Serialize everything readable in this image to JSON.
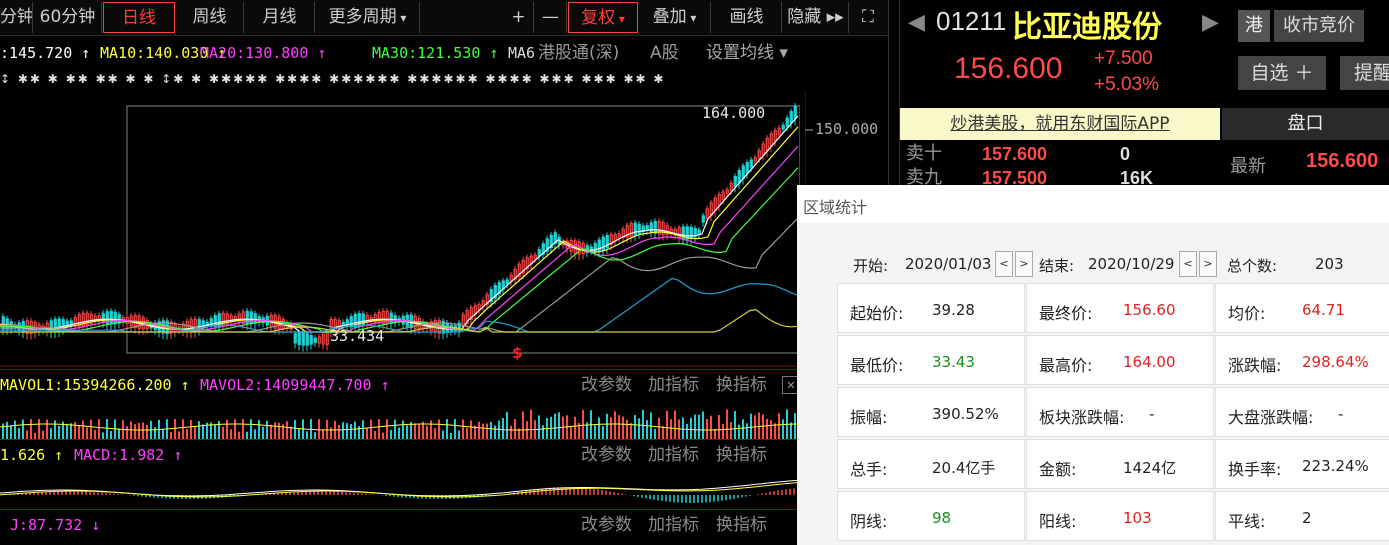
{
  "toolbar": {
    "items": [
      "分钟",
      "60分钟",
      "日线",
      "周线",
      "月线",
      "更多周期",
      "+",
      "—",
      "复权",
      "叠加",
      "画线",
      "隐藏",
      "⛶"
    ]
  },
  "ma_legend": [
    {
      "text": ":145.720 ↑",
      "color": "#ffffff"
    },
    {
      "text": "MA10:140.030 ↑",
      "color": "#ffff40"
    },
    {
      "text": "MA20:130.800 ↑",
      "color": "#ff40ff"
    },
    {
      "text": "MA30:121.530 ↑",
      "color": "#40ff40"
    },
    {
      "text": "MA6",
      "color": "#dddddd"
    }
  ],
  "chart_tabs": {
    "hk_connect": "港股通(深)",
    "a_share": "A股",
    "settings": "设置均线"
  },
  "markers": "↕ ✱✱ ✱   ✱✱ ✱✱   ✱ ✱  ↕✱ ✱   ✱✱✱✱✱ ✱✱✱✱ ✱✱✱✱✱✱  ✱✱✱✱✱✱ ✱✱✱✱  ✱✱✱ ✱✱✱  ✱✱ ✱",
  "price_axis": {
    "label": "150.000"
  },
  "peak_label": "164.000",
  "trough_label": "33.434",
  "s_marker": "$",
  "indicators": [
    {
      "left": "MAVOL1:15394266.200 ↑",
      "right": "MAVOL2:14099447.700 ↑",
      "left_color": "#ffff40",
      "right_color": "#ff40ff"
    },
    {
      "left": "1.626 ↑",
      "right": "MACD:1.982 ↑",
      "left_color": "#ffff40",
      "right_color": "#ff40ff"
    },
    {
      "left": "J:87.732 ↓",
      "right": "",
      "left_color": "#ff40ff",
      "right_color": "#ff40ff"
    }
  ],
  "indicator_buttons": {
    "params": "改参数",
    "add": "加指标",
    "switch": "换指标",
    "close": "✕"
  },
  "stock": {
    "code": "01211",
    "name": "比亚迪股份",
    "market": "港",
    "auction": "收市竞价",
    "price": "156.600",
    "change": "+7.500",
    "change_pct": "+5.03%",
    "watch": "自选 ＋",
    "remind": "提醒"
  },
  "ad_text": "炒港美股，就用东财国际APP",
  "tab_pankou": "盘口",
  "order_book": [
    {
      "label": "卖十",
      "price": "157.600",
      "vol": "0"
    },
    {
      "label": "卖九",
      "price": "157.500",
      "vol": "16K"
    }
  ],
  "latest": {
    "label": "最新",
    "value": "156.600"
  },
  "stats": {
    "title": "区域统计",
    "start_label": "开始:",
    "start": "2020/01/03",
    "end_label": "结束:",
    "end": "2020/10/29",
    "count_label": "总个数:",
    "count": "203",
    "cells": [
      {
        "k": "起始价:",
        "v": "39.28",
        "tone": ""
      },
      {
        "k": "最终价:",
        "v": "156.60",
        "tone": "red"
      },
      {
        "k": "均价:",
        "v": "64.71",
        "tone": "red"
      },
      {
        "k": "最低价:",
        "v": "33.43",
        "tone": "green"
      },
      {
        "k": "最高价:",
        "v": "164.00",
        "tone": "red"
      },
      {
        "k": "涨跌幅:",
        "v": "298.64%",
        "tone": "red"
      },
      {
        "k": "振幅:",
        "v": "390.52%",
        "tone": ""
      },
      {
        "k": "板块涨跌幅:",
        "v": "-",
        "tone": ""
      },
      {
        "k": "大盘涨跌幅:",
        "v": "-",
        "tone": ""
      },
      {
        "k": "总手:",
        "v": "20.4亿手",
        "tone": ""
      },
      {
        "k": "金额:",
        "v": "1424亿",
        "tone": ""
      },
      {
        "k": "换手率:",
        "v": "223.24%",
        "tone": ""
      },
      {
        "k": "阴线:",
        "v": "98",
        "tone": "green"
      },
      {
        "k": "阳线:",
        "v": "103",
        "tone": "red"
      },
      {
        "k": "平线:",
        "v": "2",
        "tone": ""
      }
    ]
  },
  "colors": {
    "up": "#ff4a4a",
    "down": "#20d0d0",
    "ma5": "#ffffff",
    "ma10": "#ffff40",
    "ma20": "#ff40ff",
    "ma30": "#40ff40"
  }
}
